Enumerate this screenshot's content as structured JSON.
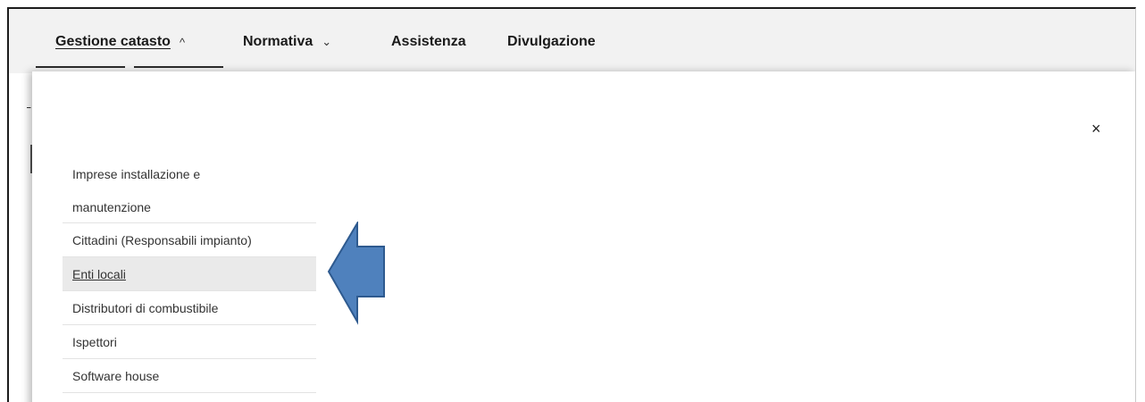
{
  "nav": {
    "items": [
      {
        "label": "Gestione catasto",
        "chevron": "^"
      },
      {
        "label": "Normativa",
        "chevron": "v"
      },
      {
        "label": "Assistenza"
      },
      {
        "label": "Divulgazione"
      }
    ]
  },
  "submenu": {
    "items": [
      {
        "label": "Imprese installazione e manutenzione"
      },
      {
        "label": "Cittadini (Responsabili impianto)"
      },
      {
        "label": "Enti locali",
        "highlighted": true
      },
      {
        "label": "Distributori di combustibile"
      },
      {
        "label": "Ispettori"
      },
      {
        "label": "Software house"
      }
    ]
  },
  "close_icon": "×",
  "annotation": {
    "arrow_color": "#4f81bd",
    "arrow_border": "#2e5a8f"
  }
}
